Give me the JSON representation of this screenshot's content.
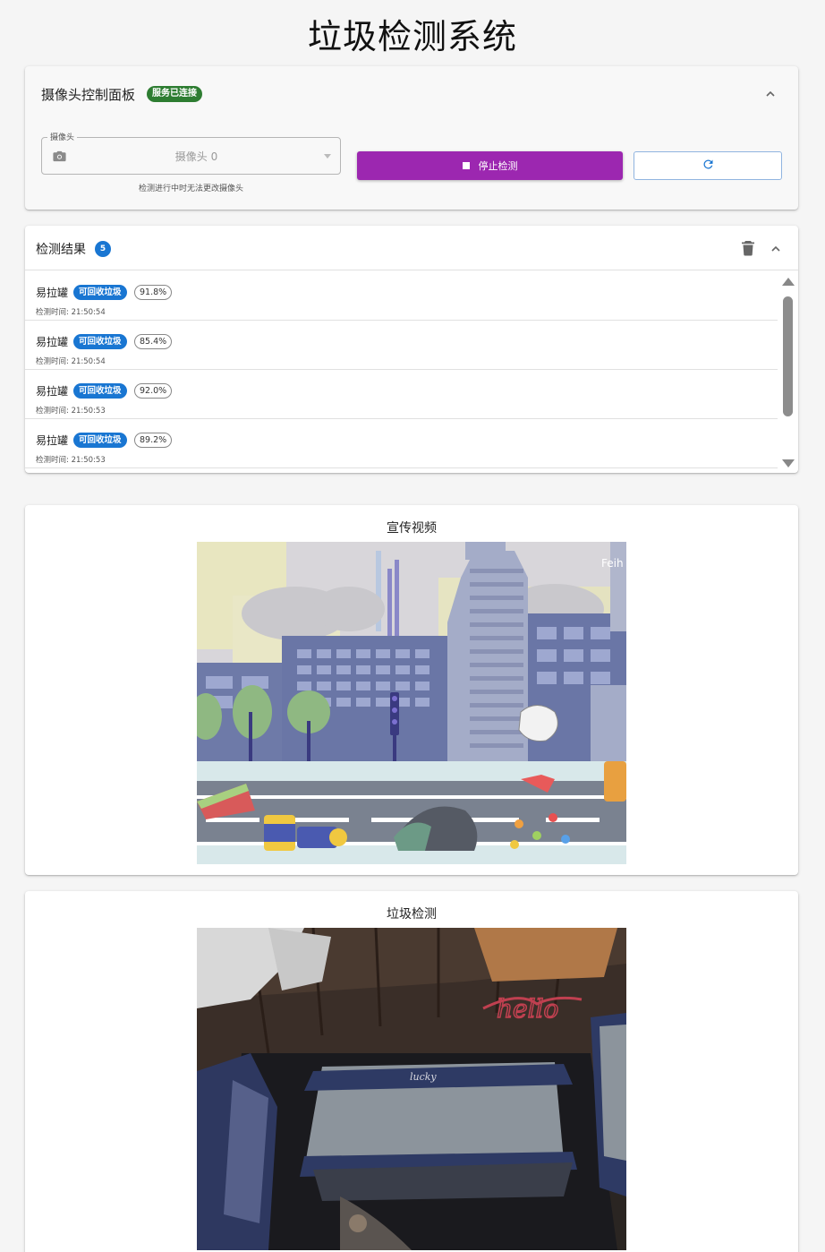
{
  "page": {
    "title": "垃圾检测系统"
  },
  "camera_panel": {
    "title": "摄像头控制面板",
    "status_badge": "服务已连接",
    "select_label": "摄像头",
    "select_value": "摄像头 0",
    "hint": "检测进行中时无法更改摄像头",
    "stop_button": "停止检测"
  },
  "results": {
    "title": "检测结果",
    "count": "5",
    "items": [
      {
        "name": "易拉罐",
        "category": "可回收垃圾",
        "confidence": "91.8%",
        "time": "检测时间: 21:50:54"
      },
      {
        "name": "易拉罐",
        "category": "可回收垃圾",
        "confidence": "85.4%",
        "time": "检测时间: 21:50:54"
      },
      {
        "name": "易拉罐",
        "category": "可回收垃圾",
        "confidence": "92.0%",
        "time": "检测时间: 21:50:53"
      },
      {
        "name": "易拉罐",
        "category": "可回收垃圾",
        "confidence": "89.2%",
        "time": "检测时间: 21:50:53"
      }
    ]
  },
  "promo_video": {
    "title": "宣传视频",
    "overlay_text": "Feih"
  },
  "detection_video": {
    "title": "垃圾检测",
    "overlay_text": "hello",
    "shelf_text": "lucky"
  },
  "colors": {
    "purple": "#9c27b0",
    "blue": "#1976d2",
    "green": "#2e7d32"
  },
  "icons": [
    "camera-icon",
    "chevron-up-icon",
    "trash-icon",
    "refresh-icon",
    "stop-icon"
  ]
}
